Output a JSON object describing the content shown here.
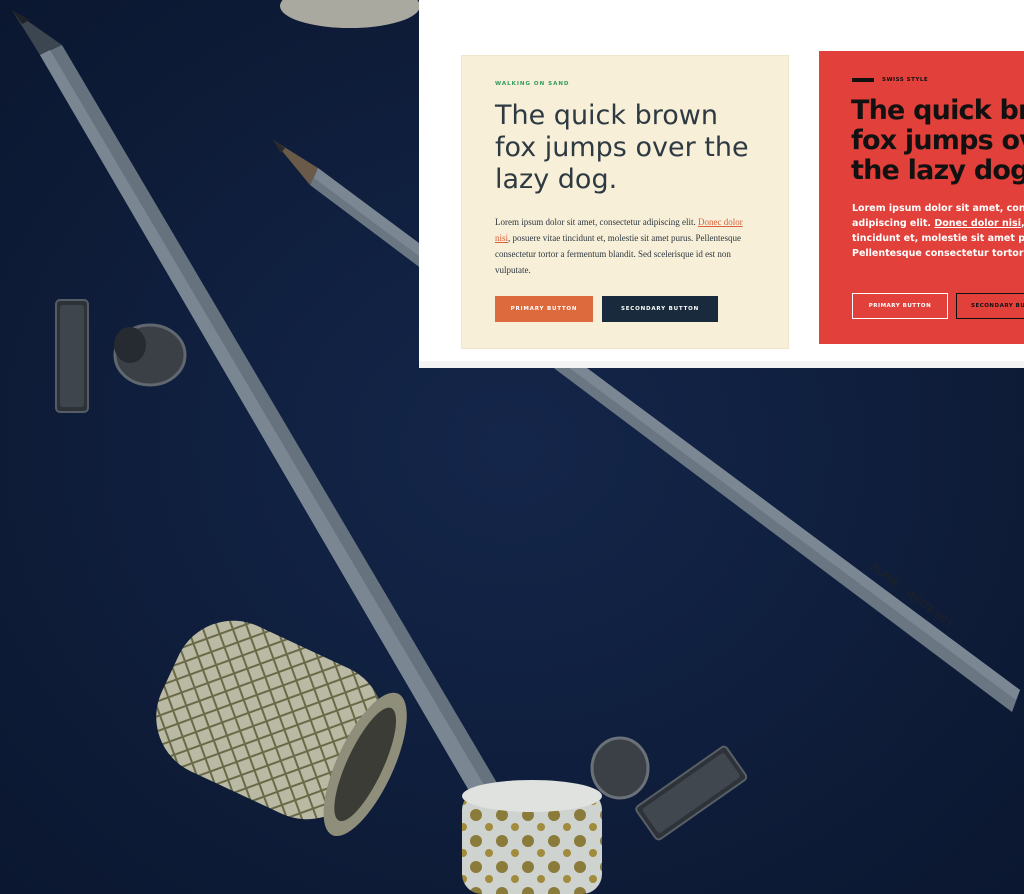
{
  "colors": {
    "background": "#0f1f3d",
    "pencil": "#5d6b78",
    "card1_bg": "#f8efd9",
    "card1_accent": "#2f9b5f",
    "card1_primary": "#dd6a3d",
    "card1_secondary": "#182a3c",
    "card2_bg": "#e2403a"
  },
  "photo": {
    "pencil_label": "BLANC - WHITE 001"
  },
  "card1": {
    "eyebrow": "WALKING ON SAND",
    "title": "The quick brown fox jumps over the lazy dog.",
    "body_before": "Lorem ipsum dolor sit amet, consectetur adipiscing elit. ",
    "body_link": "Donec dolor nisi",
    "body_after": ", posuere vitae tincidunt et, molestie sit amet purus. Pellentesque consectetur tortor a fermentum blandit. Sed scelerisque id est non vulputate.",
    "primary_button": "PRIMARY BUTTON",
    "secondary_button": "SECONDARY BUTTON"
  },
  "card2": {
    "eyebrow": "SWISS STYLE",
    "title": "The quick brown fox jumps over the lazy dog.",
    "body_before": "Lorem ipsum dolor sit amet, consectetur adipiscing elit. ",
    "body_link": "Donec dolor nisi",
    "body_after": ", posuere vitae tincidunt et, molestie sit amet purus. Pellentesque consectetur tortor a fermentum.",
    "primary_button": "PRIMARY BUTTON",
    "secondary_button": "SECONDARY BUTTON"
  }
}
